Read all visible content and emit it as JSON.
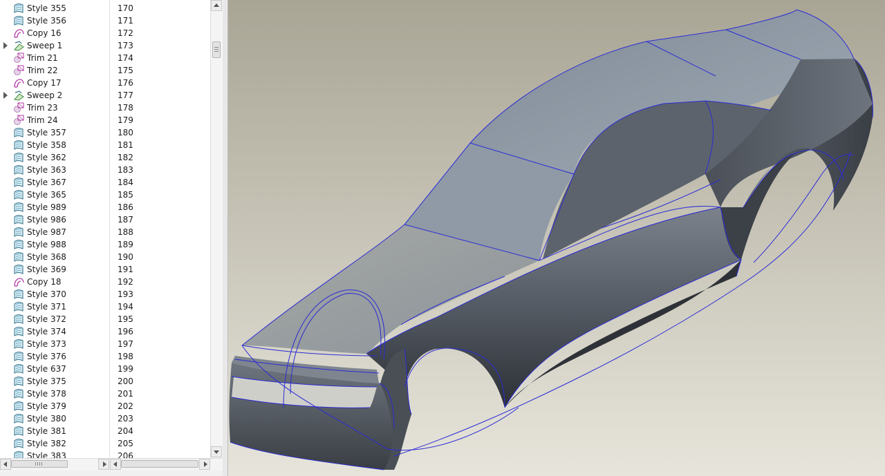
{
  "model_tree": {
    "items": [
      {
        "name": "Style 355",
        "num": "170",
        "type": "style",
        "expandable": false
      },
      {
        "name": "Style 356",
        "num": "171",
        "type": "style",
        "expandable": false
      },
      {
        "name": "Copy 16",
        "num": "172",
        "type": "copy",
        "expandable": false
      },
      {
        "name": "Sweep 1",
        "num": "173",
        "type": "sweep",
        "expandable": true
      },
      {
        "name": "Trim 21",
        "num": "174",
        "type": "trim",
        "expandable": false
      },
      {
        "name": "Trim 22",
        "num": "175",
        "type": "trim",
        "expandable": false
      },
      {
        "name": "Copy 17",
        "num": "176",
        "type": "copy",
        "expandable": false
      },
      {
        "name": "Sweep 2",
        "num": "177",
        "type": "sweep",
        "expandable": true
      },
      {
        "name": "Trim 23",
        "num": "178",
        "type": "trim",
        "expandable": false
      },
      {
        "name": "Trim 24",
        "num": "179",
        "type": "trim",
        "expandable": false
      },
      {
        "name": "Style 357",
        "num": "180",
        "type": "style",
        "expandable": false
      },
      {
        "name": "Style 358",
        "num": "181",
        "type": "style",
        "expandable": false
      },
      {
        "name": "Style 362",
        "num": "182",
        "type": "style",
        "expandable": false
      },
      {
        "name": "Style 363",
        "num": "183",
        "type": "style",
        "expandable": false
      },
      {
        "name": "Style 367",
        "num": "184",
        "type": "style",
        "expandable": false
      },
      {
        "name": "Style 365",
        "num": "185",
        "type": "style",
        "expandable": false
      },
      {
        "name": "Style 989",
        "num": "186",
        "type": "style",
        "expandable": false
      },
      {
        "name": "Style 986",
        "num": "187",
        "type": "style",
        "expandable": false
      },
      {
        "name": "Style 987",
        "num": "188",
        "type": "style",
        "expandable": false
      },
      {
        "name": "Style 988",
        "num": "189",
        "type": "style",
        "expandable": false
      },
      {
        "name": "Style 368",
        "num": "190",
        "type": "style",
        "expandable": false
      },
      {
        "name": "Style 369",
        "num": "191",
        "type": "style",
        "expandable": false
      },
      {
        "name": "Copy 18",
        "num": "192",
        "type": "copy",
        "expandable": false
      },
      {
        "name": "Style 370",
        "num": "193",
        "type": "style",
        "expandable": false
      },
      {
        "name": "Style 371",
        "num": "194",
        "type": "style",
        "expandable": false
      },
      {
        "name": "Style 372",
        "num": "195",
        "type": "style",
        "expandable": false
      },
      {
        "name": "Style 374",
        "num": "196",
        "type": "style",
        "expandable": false
      },
      {
        "name": "Style 373",
        "num": "197",
        "type": "style",
        "expandable": false
      },
      {
        "name": "Style 376",
        "num": "198",
        "type": "style",
        "expandable": false
      },
      {
        "name": "Style 637",
        "num": "199",
        "type": "style",
        "expandable": false
      },
      {
        "name": "Style 375",
        "num": "200",
        "type": "style",
        "expandable": false
      },
      {
        "name": "Style 378",
        "num": "201",
        "type": "style",
        "expandable": false
      },
      {
        "name": "Style 379",
        "num": "202",
        "type": "style",
        "expandable": false
      },
      {
        "name": "Style 380",
        "num": "203",
        "type": "style",
        "expandable": false
      },
      {
        "name": "Style 381",
        "num": "204",
        "type": "style",
        "expandable": false
      },
      {
        "name": "Style 382",
        "num": "205",
        "type": "style",
        "expandable": false
      },
      {
        "name": "Style 383",
        "num": "206",
        "type": "style",
        "expandable": false
      }
    ]
  },
  "icons": {
    "style": "style-surface-icon",
    "copy": "copy-surface-icon",
    "sweep": "sweep-icon",
    "trim": "trim-icon",
    "expand": "expand-arrow-icon"
  },
  "colors": {
    "edge_line": "#2b2bd6",
    "surface_light": "#8d98a5",
    "surface_dark": "#3c4048",
    "viewport_bg_top": "#aeaa9c",
    "viewport_bg_bottom": "#e5e3d8"
  }
}
